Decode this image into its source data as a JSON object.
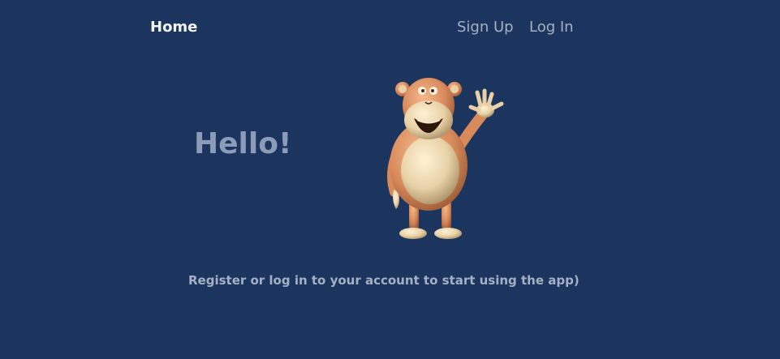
{
  "nav": {
    "home_label": "Home",
    "signup_label": "Sign Up",
    "login_label": "Log In"
  },
  "hero": {
    "greeting": "Hello!",
    "mascot_icon": "waving-monkey-icon",
    "subtitle": "Register or log in to your account to start using the app)"
  },
  "colors": {
    "background": "#1c355e",
    "nav_active": "#f2f4f8",
    "nav_inactive": "#a4b0c4",
    "greeting": "#8c9cb8"
  }
}
